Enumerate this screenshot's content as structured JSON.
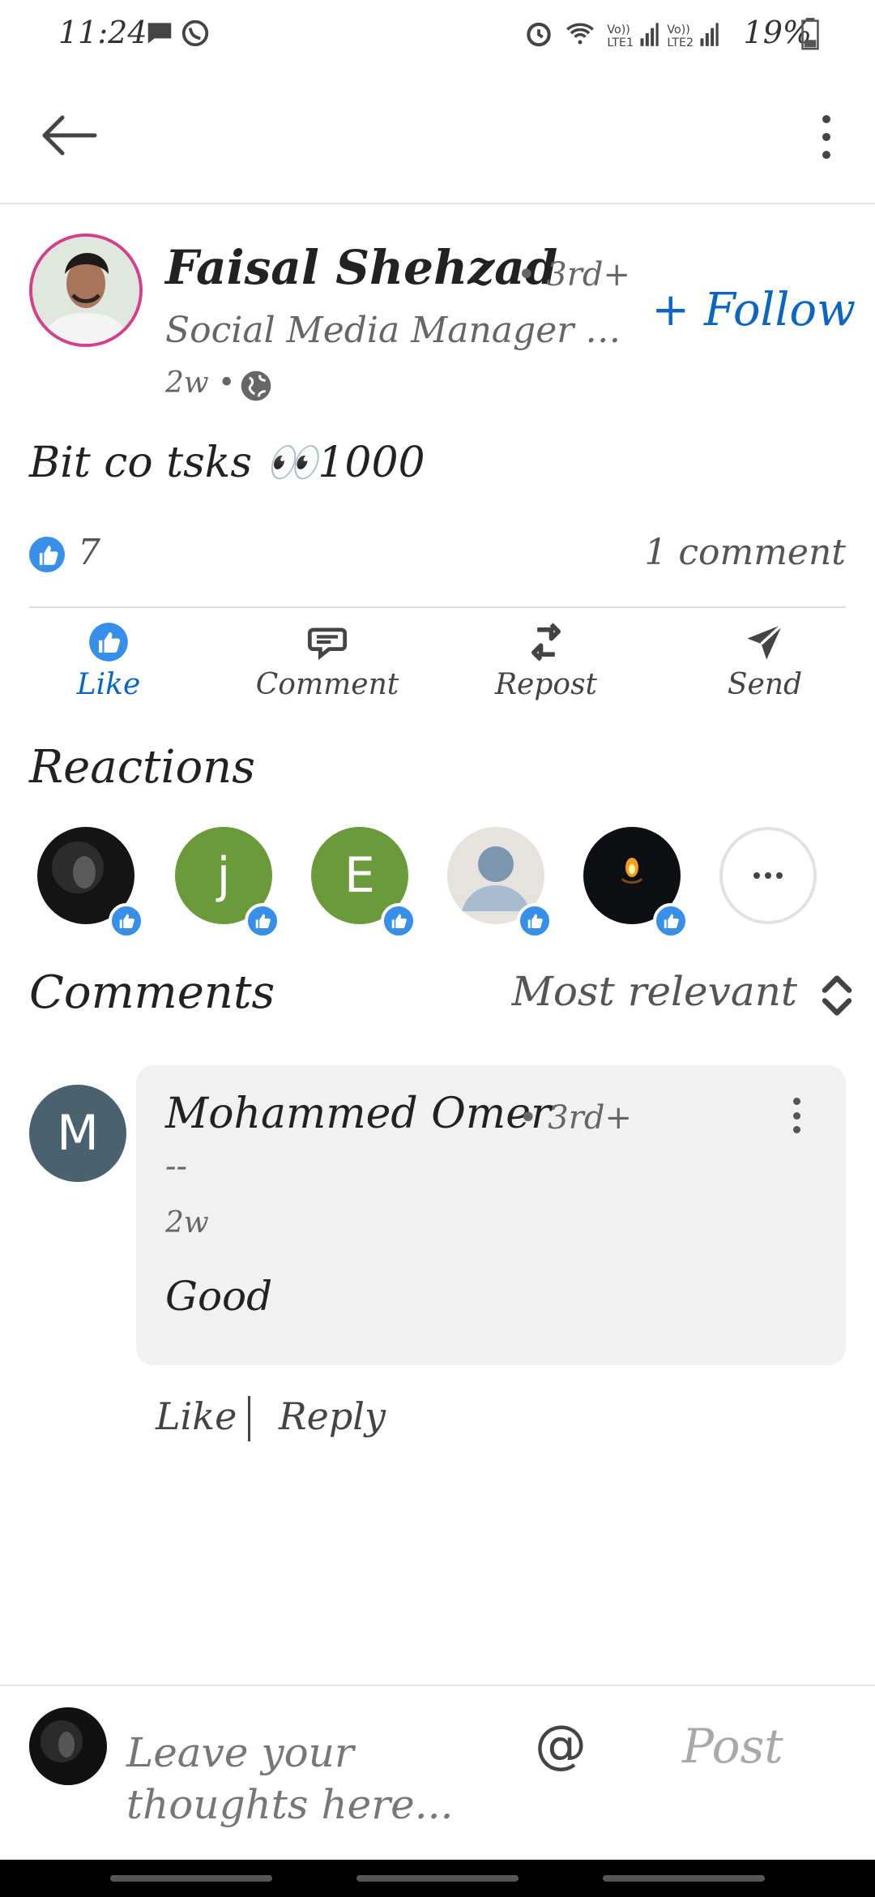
{
  "status_bar": {
    "time": "11:24",
    "battery": "19%",
    "icons": [
      "chat-bubble-icon",
      "whatsapp-icon",
      "alarm-icon",
      "wifi-icon",
      "signal-lte1-icon",
      "signal-lte2-icon",
      "battery-icon"
    ]
  },
  "top_bar": {
    "back_icon": "arrow-left-icon",
    "menu_icon": "more-vertical-icon"
  },
  "post": {
    "author_name": "Faisal Shehzad",
    "author_degree": "• 3rd+",
    "author_headline": "Social Media Manager at ...",
    "age": "2w •",
    "visibility_icon": "globe-icon",
    "follow_label": "+ Follow",
    "text": "Bit co tsks 👀1000",
    "reaction_count": "7",
    "comment_count": "1 comment"
  },
  "actions": [
    {
      "label": "Like",
      "icon": "thumbs-up-icon",
      "active": true
    },
    {
      "label": "Comment",
      "icon": "comment-icon"
    },
    {
      "label": "Repost",
      "icon": "repost-icon"
    },
    {
      "label": "Send",
      "icon": "send-icon"
    }
  ],
  "reactions": {
    "heading": "Reactions",
    "avatars": [
      {
        "kind": "photo-dark"
      },
      {
        "kind": "letter",
        "letter": "j",
        "color": "#6b9a3a"
      },
      {
        "kind": "letter",
        "letter": "E",
        "color": "#6b9a3a"
      },
      {
        "kind": "placeholder"
      },
      {
        "kind": "photo-candle"
      },
      {
        "kind": "more"
      }
    ]
  },
  "comments": {
    "heading": "Comments",
    "sort_label": "Most relevant",
    "items": [
      {
        "avatar_letter": "M",
        "name": "Mohammed Omer",
        "degree": "• 3rd+",
        "headline": "--",
        "age": "2w",
        "text": "Good",
        "like_label": "Like",
        "reply_label": "Reply"
      }
    ]
  },
  "composer": {
    "placeholder": "Leave your thoughts here...",
    "mention_label": "@",
    "post_label": "Post"
  },
  "colors": {
    "accent": "#0a66c2",
    "reaction_blue": "#378fe9",
    "avatar_ring": "#d1428d"
  }
}
